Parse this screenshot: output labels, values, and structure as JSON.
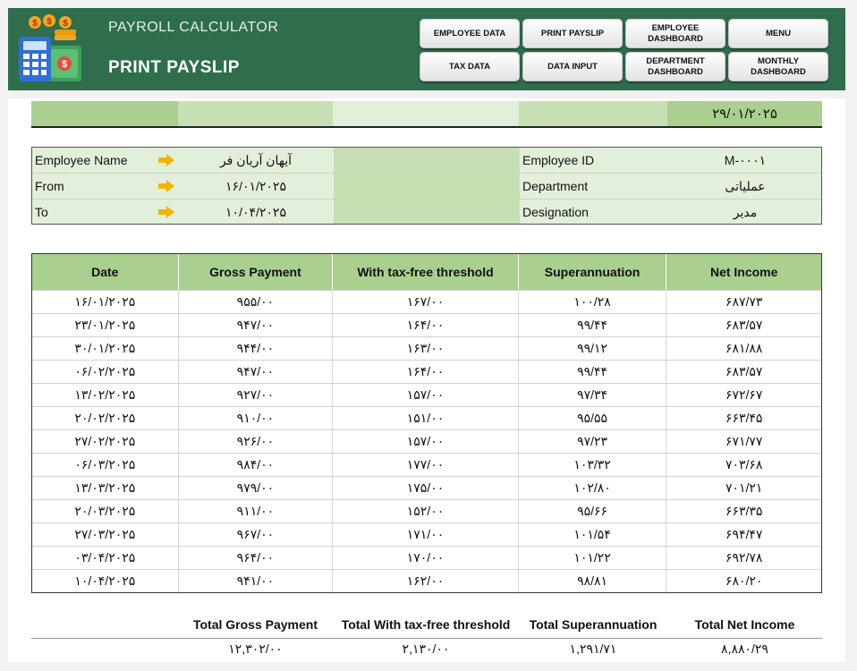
{
  "header": {
    "app_title": "PAYROLL CALCULATOR",
    "page_title": "PRINT PAYSLIP",
    "nav": [
      {
        "id": "employee-data",
        "label": "EMPLOYEE DATA"
      },
      {
        "id": "print-payslip",
        "label": "PRINT PAYSLIP"
      },
      {
        "id": "employee-dashboard",
        "label": "EMPLOYEE DASHBOARD"
      },
      {
        "id": "menu",
        "label": "MENU"
      },
      {
        "id": "tax-data",
        "label": "TAX DATA"
      },
      {
        "id": "data-input",
        "label": "DATA INPUT"
      },
      {
        "id": "department-dashboard",
        "label": "DEPARTMENT DASHBOARD"
      },
      {
        "id": "monthly-dashboard",
        "label": "MONTHLY DASHBOARD"
      }
    ]
  },
  "top_date": "۲۹/۰۱/۲۰۲۵",
  "info": {
    "employee_name_label": "Employee Name",
    "employee_name": "آیهان آریان فر",
    "from_label": "From",
    "from": "۱۶/۰۱/۲۰۲۵",
    "to_label": "To",
    "to": "۱۰/۰۴/۲۰۲۵",
    "employee_id_label": "Employee ID",
    "employee_id": "M-۰۰۰۱",
    "department_label": "Department",
    "department": "عملیاتی",
    "designation_label": "Designation",
    "designation": "مدیر"
  },
  "table": {
    "headers": [
      "Date",
      "Gross Payment",
      "With tax-free threshold",
      "Superannuation",
      "Net Income"
    ],
    "rows": [
      [
        "۱۶/۰۱/۲۰۲۵",
        "۹۵۵/۰۰",
        "۱۶۷/۰۰",
        "۱۰۰/۲۸",
        "۶۸۷/۷۳"
      ],
      [
        "۲۳/۰۱/۲۰۲۵",
        "۹۴۷/۰۰",
        "۱۶۴/۰۰",
        "۹۹/۴۴",
        "۶۸۳/۵۷"
      ],
      [
        "۳۰/۰۱/۲۰۲۵",
        "۹۴۴/۰۰",
        "۱۶۳/۰۰",
        "۹۹/۱۲",
        "۶۸۱/۸۸"
      ],
      [
        "۰۶/۰۲/۲۰۲۵",
        "۹۴۷/۰۰",
        "۱۶۴/۰۰",
        "۹۹/۴۴",
        "۶۸۳/۵۷"
      ],
      [
        "۱۳/۰۲/۲۰۲۵",
        "۹۲۷/۰۰",
        "۱۵۷/۰۰",
        "۹۷/۳۴",
        "۶۷۲/۶۷"
      ],
      [
        "۲۰/۰۲/۲۰۲۵",
        "۹۱۰/۰۰",
        "۱۵۱/۰۰",
        "۹۵/۵۵",
        "۶۶۳/۴۵"
      ],
      [
        "۲۷/۰۲/۲۰۲۵",
        "۹۲۶/۰۰",
        "۱۵۷/۰۰",
        "۹۷/۲۳",
        "۶۷۱/۷۷"
      ],
      [
        "۰۶/۰۳/۲۰۲۵",
        "۹۸۴/۰۰",
        "۱۷۷/۰۰",
        "۱۰۳/۳۲",
        "۷۰۳/۶۸"
      ],
      [
        "۱۳/۰۳/۲۰۲۵",
        "۹۷۹/۰۰",
        "۱۷۵/۰۰",
        "۱۰۲/۸۰",
        "۷۰۱/۲۱"
      ],
      [
        "۲۰/۰۳/۲۰۲۵",
        "۹۱۱/۰۰",
        "۱۵۲/۰۰",
        "۹۵/۶۶",
        "۶۶۳/۳۵"
      ],
      [
        "۲۷/۰۳/۲۰۲۵",
        "۹۶۷/۰۰",
        "۱۷۱/۰۰",
        "۱۰۱/۵۴",
        "۶۹۴/۴۷"
      ],
      [
        "۰۳/۰۴/۲۰۲۵",
        "۹۶۴/۰۰",
        "۱۷۰/۰۰",
        "۱۰۱/۲۲",
        "۶۹۲/۷۸"
      ],
      [
        "۱۰/۰۴/۲۰۲۵",
        "۹۴۱/۰۰",
        "۱۶۲/۰۰",
        "۹۸/۸۱",
        "۶۸۰/۲۰"
      ]
    ]
  },
  "totals": {
    "gross_label": "Total Gross Payment",
    "gross_value": "۱۲,۳۰۲/۰۰",
    "tax_label": "Total With tax-free threshold",
    "tax_value": "۲,۱۳۰/۰۰",
    "super_label": "Total Superannuation",
    "super_value": "۱,۲۹۱/۷۱",
    "net_label": "Total Net Income",
    "net_value": "۸,۸۸۰/۲۹"
  },
  "colors": {
    "header_bg": "#2e6e4d",
    "table_header": "#a9d08e",
    "info_bg": "#e2efda",
    "arrow": "#f5b400"
  },
  "icons": [
    "calculator-money-logo",
    "arrow-right-icon"
  ]
}
